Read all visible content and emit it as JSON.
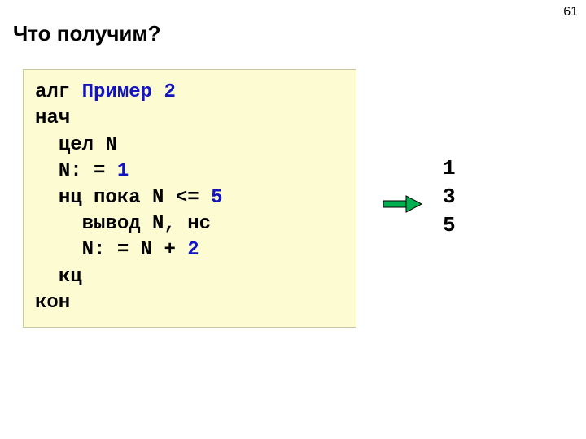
{
  "page_number": "61",
  "title": "Что получим?",
  "code": {
    "kw_alg": "алг",
    "alg_name": "Пример 2",
    "kw_nach": "нач",
    "kw_cel": "цел",
    "var_N": "N",
    "assign_lhs": "N:",
    "assign_eq": "=",
    "lit_1": "1",
    "kw_nc": "нц пока",
    "cond_var": "N",
    "cond_op": "<=",
    "lit_5": "5",
    "kw_vyvod": "вывод",
    "vyvod_args": "N, нс",
    "step_lhs": "N:",
    "step_eq": "=",
    "step_rhs_n": "N",
    "step_plus": "+",
    "lit_2": "2",
    "kw_kc": "кц",
    "kw_kon": "кон"
  },
  "output_lines": "1\n3\n5"
}
